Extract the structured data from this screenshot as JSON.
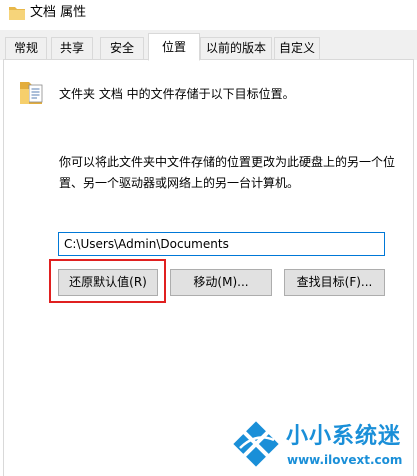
{
  "window": {
    "title": "文档 属性"
  },
  "tabs": [
    {
      "label": "常规",
      "active": false
    },
    {
      "label": "共享",
      "active": false
    },
    {
      "label": "安全",
      "active": false
    },
    {
      "label": "位置",
      "active": true
    },
    {
      "label": "以前的版本",
      "active": false
    },
    {
      "label": "自定义",
      "active": false
    }
  ],
  "location": {
    "folder_icon": "folder-document-icon",
    "description": "文件夹 文档 中的文件存储于以下目标位置。",
    "explanation": "你可以将此文件夹中文件存储的位置更改为此硬盘上的另一个位置、另一个驱动器或网络上的另一台计算机。",
    "path_value": "C:\\Users\\Admin\\Documents",
    "restore_default_label": "还原默认值(R)",
    "move_label": "移动(M)...",
    "find_target_label": "查找目标(F)..."
  },
  "watermark": {
    "name": "小小系统迷",
    "url": "www.ilovext.com"
  },
  "colors": {
    "accent_blue": "#0078d7",
    "highlight_red": "#e02020",
    "watermark_blue": "#1a8fd8"
  }
}
